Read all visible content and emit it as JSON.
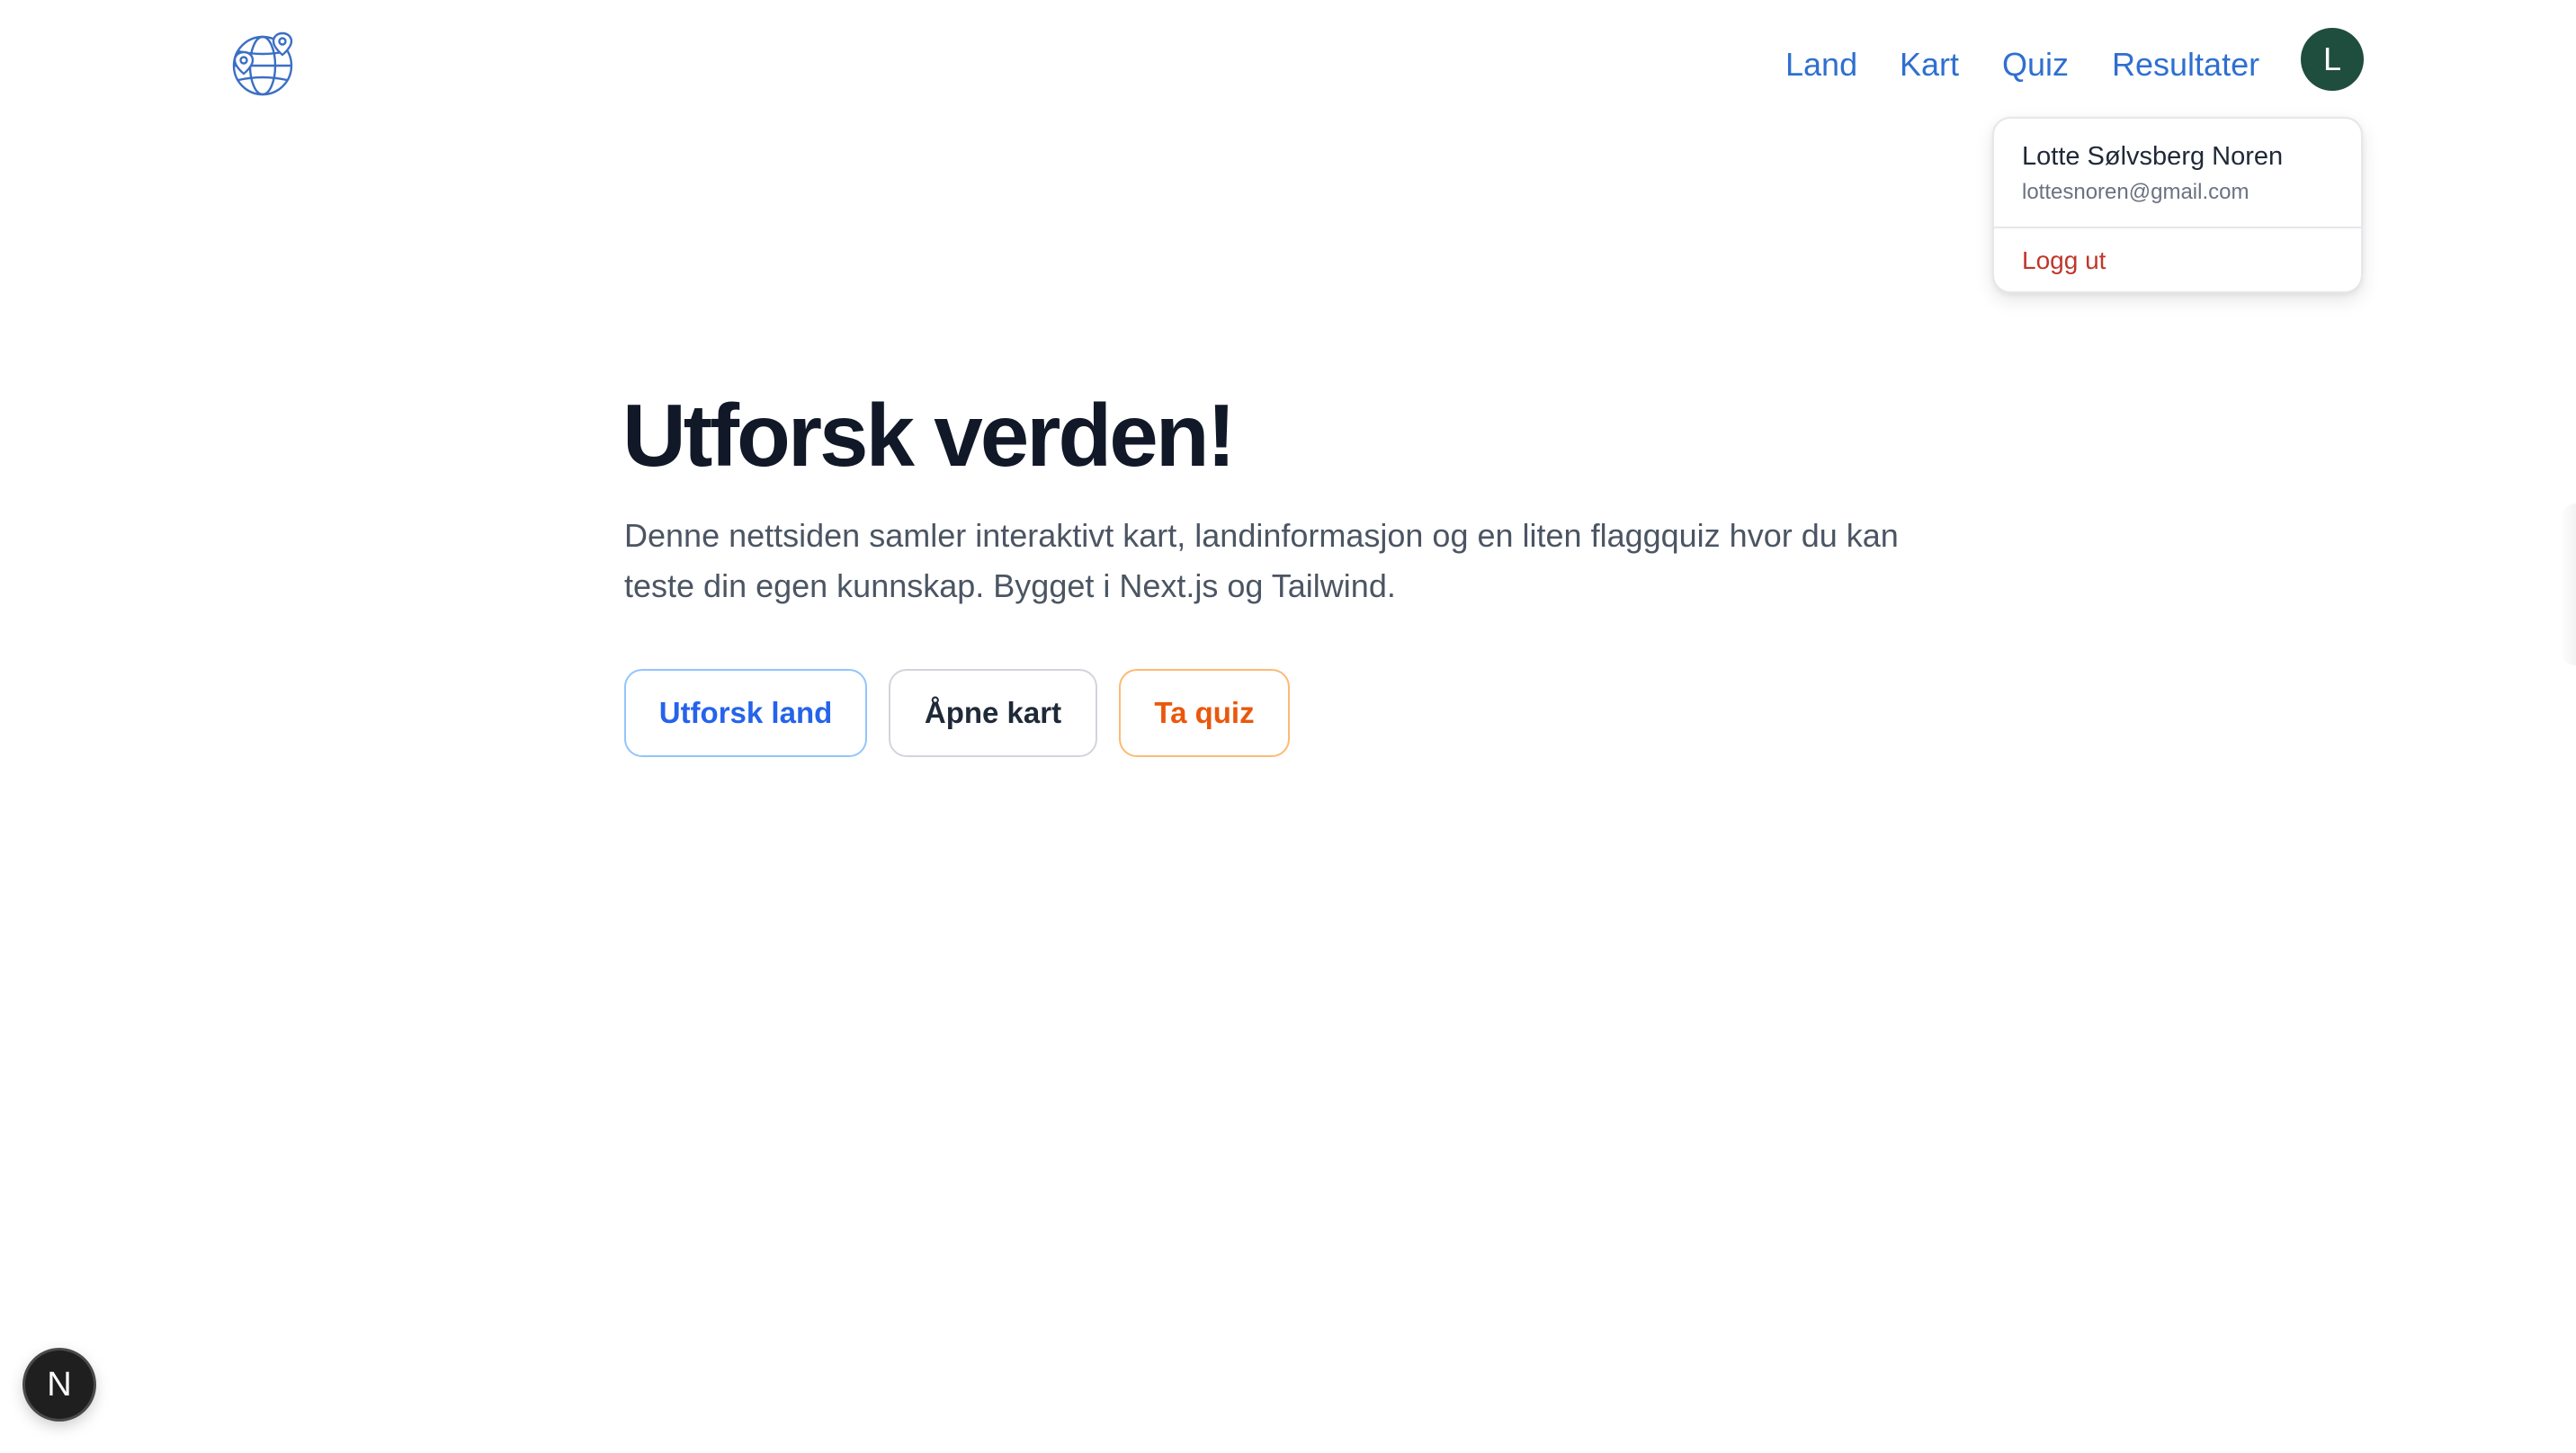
{
  "header": {
    "logo_icon": "globe-location-icon",
    "nav": [
      {
        "label": "Land"
      },
      {
        "label": "Kart"
      },
      {
        "label": "Quiz"
      },
      {
        "label": "Resultater"
      }
    ],
    "avatar_initial": "L"
  },
  "user_menu": {
    "name": "Lotte Sølvsberg Noren",
    "email": "lottesnoren@gmail.com",
    "logout_label": "Logg ut"
  },
  "hero": {
    "title": "Utforsk verden!",
    "description": "Denne nettsiden samler interaktivt kart, landinformasjon og en liten flaggquiz hvor du kan teste din egen kunnskap. Bygget i Next.js og Tailwind.",
    "buttons": {
      "explore": "Utforsk land",
      "map": "Åpne kart",
      "quiz": "Ta quiz"
    }
  },
  "dev_indicator": {
    "label": "N"
  },
  "colors": {
    "nav_link": "#2f6fd0",
    "avatar_bg": "#1f4d3e",
    "logout": "#c0362c",
    "title": "#111827",
    "explore_accent": "#2563eb",
    "quiz_accent": "#ea580c"
  }
}
